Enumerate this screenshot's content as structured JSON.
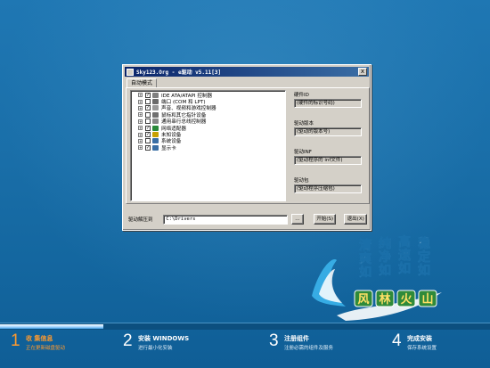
{
  "window": {
    "title": "Sky123.Org - e驱动 v5.11[3]",
    "close_label": "x"
  },
  "tab": {
    "label": "自动模式"
  },
  "tree": {
    "items": [
      {
        "label": "IDE ATA/ATAPI 控制器",
        "checked": true,
        "icon_color": "#808080"
      },
      {
        "label": "端口 (COM 和 LPT)",
        "checked": false,
        "icon_color": "#6b6b6b"
      },
      {
        "label": "声音、视频和游戏控制器",
        "checked": true,
        "icon_color": "#9a9a9a"
      },
      {
        "label": "鼠标和其它指针设备",
        "checked": false,
        "icon_color": "#707070"
      },
      {
        "label": "通用串行总线控制器",
        "checked": false,
        "icon_color": "#888888"
      },
      {
        "label": "网络适配器",
        "checked": true,
        "icon_color": "#2a8a3a"
      },
      {
        "label": "未知设备",
        "checked": true,
        "icon_color": "#c8a000"
      },
      {
        "label": "系统设备",
        "checked": false,
        "icon_color": "#3a6ea5"
      },
      {
        "label": "显示卡",
        "checked": true,
        "icon_color": "#3a6ea5"
      }
    ]
  },
  "details": {
    "hardware_id_label": "硬件ID",
    "hardware_id_value": "(硬件的标识号码)",
    "driver_version_label": "驱动版本",
    "driver_version_value": "(驱动的版本号)",
    "driver_inf_label": "驱动INF",
    "driver_inf_value": "(驱动程序的 inf文件)",
    "driver_pack_label": "驱动包",
    "driver_pack_value": "(驱动程序压缩包)"
  },
  "extract": {
    "label": "驱动解压到",
    "path_value": "C:\\Drivers",
    "browse_label": "...",
    "start_label": "开始(S)",
    "exit_label": "退出(X)"
  },
  "logo": {
    "words": [
      "清爽如",
      "纯净如",
      "高速如",
      "稳定如"
    ],
    "brand": [
      "风",
      "林",
      "火",
      "山"
    ],
    "colors": {
      "pillar_text": "#ffffff",
      "tile_bg": "#2f8a3a",
      "wave": "#39b0e8",
      "wave_dark": "#1a6fa9"
    }
  },
  "progress": {
    "fraction": 0.21
  },
  "steps": [
    {
      "num": "1",
      "title": "收    集信息",
      "subtitle": "正在更新磁盘驱动",
      "active": true
    },
    {
      "num": "2",
      "title": "安装 WINDOWS",
      "subtitle": "进行最小化安装",
      "active": false
    },
    {
      "num": "3",
      "title": "注册组件",
      "subtitle": "注册必需的组件及服务",
      "active": false
    },
    {
      "num": "4",
      "title": "完成安装",
      "subtitle": "保存系统设置",
      "active": false
    }
  ]
}
